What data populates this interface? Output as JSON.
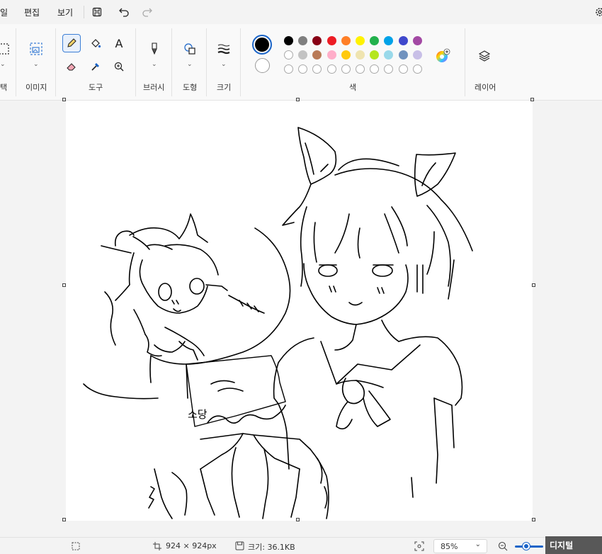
{
  "menu": {
    "file": "일",
    "edit": "편집",
    "view": "보기"
  },
  "ribbon": {
    "groups": {
      "select": "택",
      "image": "이미지",
      "tools": "도구",
      "brushes": "브러시",
      "shapes": "도형",
      "size": "크기",
      "colors": "색",
      "layers": "레이어"
    },
    "text_tool_glyph": "A"
  },
  "palette": {
    "primary": "#000000",
    "secondary": "#ffffff",
    "row1": [
      "#000000",
      "#7f7f7f",
      "#880015",
      "#ed1c24",
      "#ff7f27",
      "#fff200",
      "#22b14c",
      "#00a2e8",
      "#3f48cc",
      "#a349a4"
    ],
    "row2": [
      "#ffffff",
      "#c3c3c3",
      "#b97a57",
      "#ffaec9",
      "#ffc90e",
      "#efe4b0",
      "#b5e61d",
      "#99d9ea",
      "#7092be",
      "#c8bfe7"
    ]
  },
  "drawing": {
    "signature_text": "소당"
  },
  "status": {
    "canvas_size": "924 × 924px",
    "file_size": "크기: 36.1KB",
    "zoom": "85%",
    "watermark": "디지털"
  }
}
